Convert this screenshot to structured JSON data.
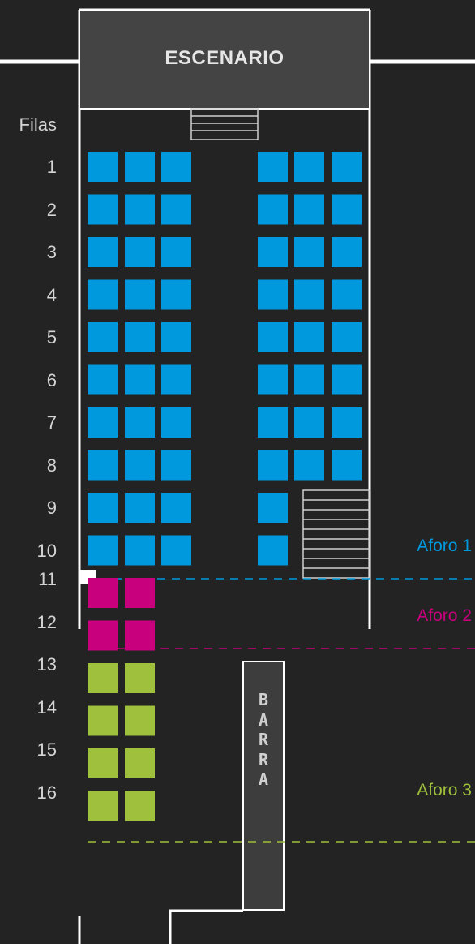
{
  "stage": {
    "label": "ESCENARIO"
  },
  "rows_header": "Filas",
  "rows": [
    "1",
    "2",
    "3",
    "4",
    "5",
    "6",
    "7",
    "8",
    "9",
    "10",
    "11",
    "12",
    "13",
    "14",
    "15",
    "16"
  ],
  "bar": {
    "label": "BARRA",
    "letters": [
      "B",
      "A",
      "R",
      "R",
      "A"
    ]
  },
  "zones": [
    {
      "label": "Aforo 1",
      "color": "#0099dd",
      "rows": "1-10"
    },
    {
      "label": "Aforo 2",
      "color": "#c8007e",
      "rows": "11-12"
    },
    {
      "label": "Aforo 3",
      "color": "#9fc03c",
      "rows": "13-16"
    }
  ],
  "seat_layout": {
    "left_block_seats_per_row": [
      3,
      3,
      3,
      3,
      3,
      3,
      3,
      3,
      3,
      3,
      2,
      2,
      2,
      2,
      2,
      2
    ],
    "right_block_seats_per_row": [
      3,
      3,
      3,
      3,
      3,
      3,
      3,
      3,
      1,
      1,
      0,
      0,
      0,
      0,
      0,
      0
    ]
  },
  "colors": {
    "background": "#232323",
    "walls": "#ffffff",
    "stage": "#444444",
    "bar": "#3d3d3d"
  }
}
